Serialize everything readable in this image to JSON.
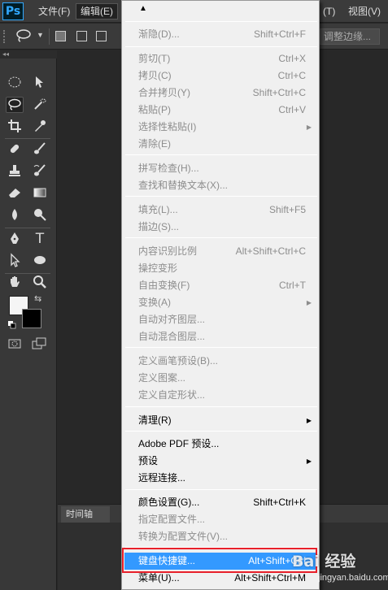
{
  "app": {
    "logo_text": "Ps"
  },
  "menubar": {
    "file": "文件(F)",
    "edit": "编辑(E)",
    "truncated_right": "(T)",
    "view": "视图(V)"
  },
  "options_bar": {
    "refine_edge": "调整边缘..."
  },
  "timeline": {
    "tab_label": "时间轴"
  },
  "edit_menu": {
    "scroll_up": "▲",
    "items": [
      {
        "label": "渐隐(D)...",
        "shortcut": "Shift+Ctrl+F",
        "enabled": false
      },
      {
        "label": "剪切(T)",
        "shortcut": "Ctrl+X",
        "enabled": false
      },
      {
        "label": "拷贝(C)",
        "shortcut": "Ctrl+C",
        "enabled": false
      },
      {
        "label": "合并拷贝(Y)",
        "shortcut": "Shift+Ctrl+C",
        "enabled": false
      },
      {
        "label": "粘贴(P)",
        "shortcut": "Ctrl+V",
        "enabled": false
      },
      {
        "label": "选择性粘贴(I)",
        "shortcut": "",
        "enabled": false,
        "submenu": true
      },
      {
        "label": "清除(E)",
        "shortcut": "",
        "enabled": false
      },
      {
        "label": "拼写检查(H)...",
        "shortcut": "",
        "enabled": false
      },
      {
        "label": "查找和替换文本(X)...",
        "shortcut": "",
        "enabled": false
      },
      {
        "label": "填充(L)...",
        "shortcut": "Shift+F5",
        "enabled": false
      },
      {
        "label": "描边(S)...",
        "shortcut": "",
        "enabled": false
      },
      {
        "label": "内容识别比例",
        "shortcut": "Alt+Shift+Ctrl+C",
        "enabled": false
      },
      {
        "label": "操控变形",
        "shortcut": "",
        "enabled": false
      },
      {
        "label": "自由变换(F)",
        "shortcut": "Ctrl+T",
        "enabled": false
      },
      {
        "label": "变换(A)",
        "shortcut": "",
        "enabled": false,
        "submenu": true
      },
      {
        "label": "自动对齐图层...",
        "shortcut": "",
        "enabled": false
      },
      {
        "label": "自动混合图层...",
        "shortcut": "",
        "enabled": false
      },
      {
        "label": "定义画笔预设(B)...",
        "shortcut": "",
        "enabled": false
      },
      {
        "label": "定义图案...",
        "shortcut": "",
        "enabled": false
      },
      {
        "label": "定义自定形状...",
        "shortcut": "",
        "enabled": false
      },
      {
        "label": "清理(R)",
        "shortcut": "",
        "enabled": true,
        "submenu": true
      },
      {
        "label": "Adobe PDF 预设...",
        "shortcut": "",
        "enabled": true
      },
      {
        "label": "预设",
        "shortcut": "",
        "enabled": true,
        "submenu": true
      },
      {
        "label": "远程连接...",
        "shortcut": "",
        "enabled": true
      },
      {
        "label": "颜色设置(G)...",
        "shortcut": "Shift+Ctrl+K",
        "enabled": true
      },
      {
        "label": "指定配置文件...",
        "shortcut": "",
        "enabled": false
      },
      {
        "label": "转换为配置文件(V)...",
        "shortcut": "",
        "enabled": false
      },
      {
        "label": "键盘快捷键...",
        "shortcut": "Alt+Shift+Ctrl",
        "enabled": true,
        "highlighted": true
      },
      {
        "label": "菜单(U)...",
        "shortcut": "Alt+Shift+Ctrl+M",
        "enabled": true
      }
    ]
  },
  "watermark": {
    "text": "Bai 经验",
    "sub": "jingyan.baidu.com"
  },
  "colors": {
    "highlight": "#3399ff",
    "callout_border": "#e8202a",
    "foreground": "#f5f5f5",
    "background": "#000000"
  }
}
